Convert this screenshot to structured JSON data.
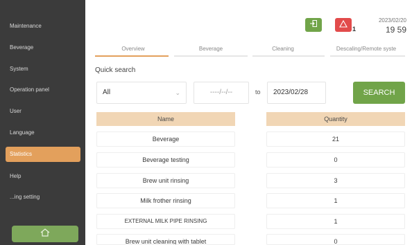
{
  "sidebar": {
    "items": [
      {
        "label": "Maintenance",
        "active": false
      },
      {
        "label": "Beverage",
        "active": false
      },
      {
        "label": "System",
        "active": false
      },
      {
        "label": "Operation panel",
        "active": false
      },
      {
        "label": "User",
        "active": false
      },
      {
        "label": "Language",
        "active": false
      },
      {
        "label": "Statistics",
        "active": true
      },
      {
        "label": "Help",
        "active": false
      },
      {
        "label": "...ing setting",
        "active": false
      }
    ],
    "home_icon": "home-icon"
  },
  "header": {
    "date": "2023/02/20",
    "time": "19 59",
    "alert_count": "1",
    "exit_icon": "exit-icon",
    "alert_icon": "warning-icon"
  },
  "tabs": [
    {
      "label": "Overview",
      "active": true
    },
    {
      "label": "Beverage",
      "active": false
    },
    {
      "label": "Cleaning",
      "active": false
    },
    {
      "label": "Descaling/Remote syste",
      "active": false
    }
  ],
  "quick_search": {
    "label": "Quick search",
    "filter_value": "All",
    "from_placeholder": "----/--/--",
    "to_label": "to",
    "to_value": "2023/02/28",
    "search_label": "SEARCH"
  },
  "table": {
    "name_header": "Name",
    "quantity_header": "Quantity",
    "rows": [
      {
        "name": "Beverage",
        "quantity": "21"
      },
      {
        "name": "Beverage testing",
        "quantity": "0"
      },
      {
        "name": "Brew unit rinsing",
        "quantity": "3"
      },
      {
        "name": "Milk frother rinsing",
        "quantity": "1"
      },
      {
        "name": "EXTERNAL MILK PIPE RINSING",
        "quantity": "1"
      },
      {
        "name": "Brew unit cleaning with tablet",
        "quantity": "0"
      }
    ]
  },
  "colors": {
    "accent": "#e3a05c",
    "green": "#71a449",
    "red": "#e24b4b",
    "sidebar": "#3b3b3b",
    "table_header": "#f1d6b5"
  }
}
